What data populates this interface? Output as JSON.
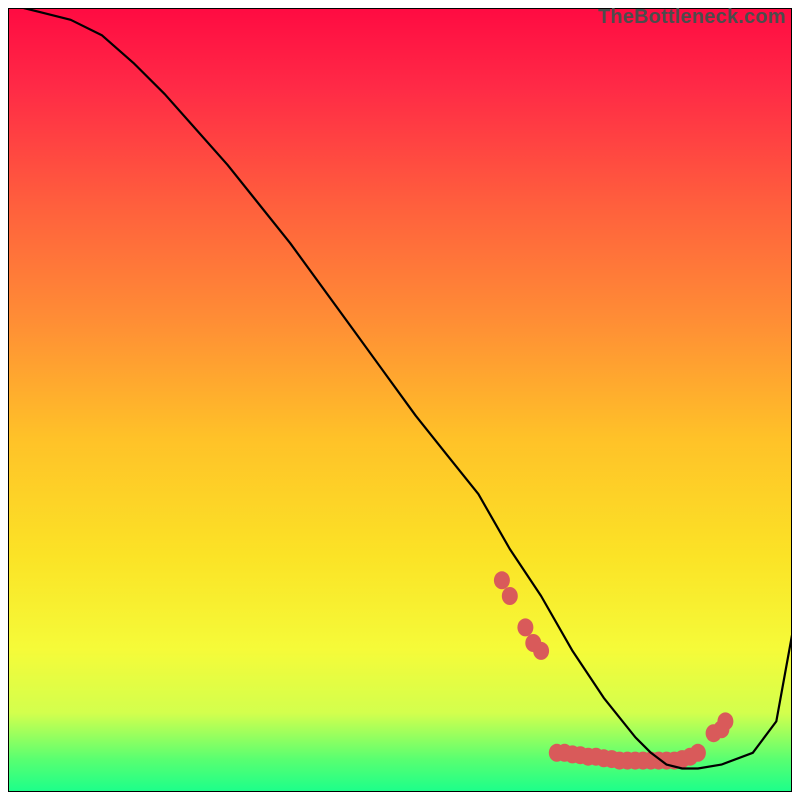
{
  "watermark": "TheBottleneck.com",
  "chart_data": {
    "type": "line",
    "title": "",
    "xlabel": "",
    "ylabel": "",
    "xlim": [
      0,
      100
    ],
    "ylim": [
      0,
      100
    ],
    "grid": false,
    "series": [
      {
        "name": "curve",
        "x": [
          2,
          4,
          8,
          12,
          16,
          20,
          28,
          36,
          44,
          52,
          56,
          60,
          64,
          68,
          72,
          76,
          80,
          82,
          84,
          86,
          88,
          91,
          95,
          98,
          100
        ],
        "y": [
          100,
          99.5,
          98.5,
          96.5,
          93,
          89,
          80,
          70,
          59,
          48,
          43,
          38,
          31,
          25,
          18,
          12,
          7,
          5,
          3.5,
          3,
          3,
          3.5,
          5,
          9,
          20
        ]
      }
    ],
    "markers": {
      "name": "highlight-dots",
      "x_range": [
        64,
        92
      ],
      "y_value": 3.3,
      "color": "#d95a5a",
      "points": [
        {
          "x": 63,
          "y": 27
        },
        {
          "x": 64,
          "y": 25
        },
        {
          "x": 66,
          "y": 21
        },
        {
          "x": 67,
          "y": 19
        },
        {
          "x": 68,
          "y": 18
        },
        {
          "x": 70,
          "y": 5
        },
        {
          "x": 71,
          "y": 5
        },
        {
          "x": 72,
          "y": 4.8
        },
        {
          "x": 73,
          "y": 4.7
        },
        {
          "x": 74,
          "y": 4.5
        },
        {
          "x": 75,
          "y": 4.5
        },
        {
          "x": 76,
          "y": 4.3
        },
        {
          "x": 77,
          "y": 4.2
        },
        {
          "x": 78,
          "y": 4
        },
        {
          "x": 79,
          "y": 4
        },
        {
          "x": 80,
          "y": 4
        },
        {
          "x": 81,
          "y": 4
        },
        {
          "x": 82,
          "y": 4
        },
        {
          "x": 83,
          "y": 4
        },
        {
          "x": 84,
          "y": 4
        },
        {
          "x": 85,
          "y": 4
        },
        {
          "x": 86,
          "y": 4.2
        },
        {
          "x": 87,
          "y": 4.5
        },
        {
          "x": 88,
          "y": 5
        },
        {
          "x": 90,
          "y": 7.5
        },
        {
          "x": 91,
          "y": 8
        },
        {
          "x": 91.5,
          "y": 9
        }
      ]
    }
  }
}
